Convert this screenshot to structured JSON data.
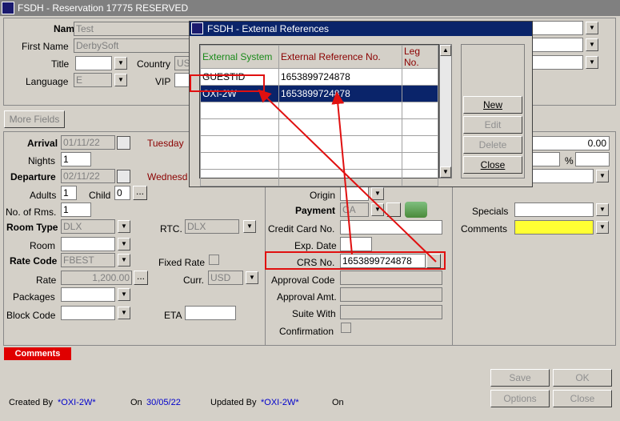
{
  "window": {
    "title": "FSDH - Reservation 17775  RESERVED"
  },
  "guest": {
    "name_label": "Name",
    "name_value": "Test",
    "first_name_label": "First Name",
    "first_name_value": "DerbySoft",
    "title_label": "Title",
    "title_value": "",
    "country_label": "Country",
    "country_value": "US",
    "language_label": "Language",
    "language_value": "E",
    "vip_label": "VIP",
    "vip_value": ""
  },
  "more_fields_label": "More Fields",
  "stay": {
    "arrival_label": "Arrival",
    "arrival_value": "01/11/22",
    "arrival_day": "Tuesday",
    "nights_label": "Nights",
    "nights_value": "1",
    "departure_label": "Departure",
    "departure_value": "02/11/22",
    "departure_day": "Wednesd",
    "adults_label": "Adults",
    "adults_value": "1",
    "child_label": "Child",
    "child_value": "0",
    "rooms_label": "No. of Rms.",
    "rooms_value": "1",
    "room_type_label": "Room Type",
    "room_type_value": "DLX",
    "rtc_label": "RTC.",
    "rtc_value": "DLX",
    "room_label": "Room",
    "room_value": "",
    "rate_code_label": "Rate Code",
    "rate_code_value": "FBEST",
    "fixed_rate_label": "Fixed Rate",
    "rate_label": "Rate",
    "rate_value": "1,200.00",
    "curr_label": "Curr.",
    "curr_value": "USD",
    "packages_label": "Packages",
    "packages_value": "",
    "block_code_label": "Block Code",
    "block_code_value": "",
    "eta_label": "ETA",
    "eta_value": ""
  },
  "payment": {
    "origin_label": "Origin",
    "origin_value": "",
    "payment_label": "Payment",
    "payment_value": "CA",
    "cc_label": "Credit Card No.",
    "cc_value": "",
    "exp_label": "Exp. Date",
    "exp_value": "",
    "crs_label": "CRS No.",
    "crs_value": "1653899724878",
    "approval_code_label": "Approval Code",
    "approval_amt_label": "Approval Amt.",
    "suite_label": "Suite With",
    "confirmation_label": "Confirmation"
  },
  "right": {
    "amount": "0.00",
    "percent_label": "%",
    "specials_label": "Specials",
    "comments_label": "Comments"
  },
  "comments_tag": "Comments",
  "footer": {
    "created_by_label": "Created By",
    "created_by_value": "*OXI-2W*",
    "on_label": "On",
    "on_value": "30/05/22",
    "updated_by_label": "Updated By",
    "updated_by_value": "*OXI-2W*",
    "updated_on_label": "On"
  },
  "bottom_buttons": {
    "save": "Save",
    "ok": "OK",
    "options": "Options",
    "close": "Close"
  },
  "popup": {
    "title": "FSDH - External References",
    "columns": [
      "External System",
      "External Reference No.",
      "Leg No."
    ],
    "rows": [
      {
        "system": "GUESTID",
        "ref": "1653899724878",
        "leg": ""
      },
      {
        "system": "OXI-2W",
        "ref": "1653899724878",
        "leg": ""
      }
    ],
    "buttons": {
      "new": "New",
      "edit": "Edit",
      "delete": "Delete",
      "close": "Close"
    }
  },
  "colors": {
    "annotation": "#e01010",
    "selected_row": "#0a246a",
    "comments_field": "#ffff33"
  }
}
